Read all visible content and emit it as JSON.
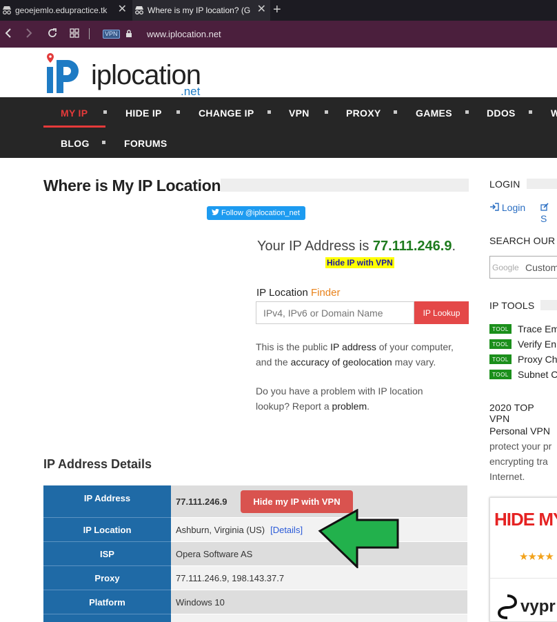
{
  "browser": {
    "tabs": [
      {
        "title": "geoejemlo.edupractice.tk",
        "active": false
      },
      {
        "title": "Where is my IP location? (G",
        "active": true
      }
    ],
    "vpn_badge": "VPN",
    "url": "www.iplocation.net"
  },
  "site": {
    "logo_text": "iplocation",
    "logo_tld": ".net",
    "nav": {
      "row1": [
        "MY IP",
        "HIDE IP",
        "CHANGE IP",
        "VPN",
        "PROXY",
        "GAMES",
        "DDOS",
        "W"
      ],
      "row2": [
        "BLOG",
        "FORUMS"
      ]
    }
  },
  "main": {
    "title": "Where is My IP Location?",
    "follow_button": "Follow @iplocation_net",
    "your_ip_prefix": "Your IP Address is",
    "your_ip": "77.111.246.9",
    "your_ip_suffix": ".",
    "hide_ip_vpn": "Hide IP with VPN",
    "finder_label": "IP Location",
    "finder_accent": "Finder",
    "input_placeholder": "IPv4, IPv6 or Domain Name",
    "lookup_button": "IP Lookup",
    "para1": {
      "a": "This is the public ",
      "b": "IP address",
      "c": " of your computer,",
      "d": "and the ",
      "e": "accuracy of geolocation",
      "f": " may vary."
    },
    "para2": {
      "a": "Do you have a problem with IP location",
      "b": "lookup? Report a ",
      "c": "problem",
      "d": "."
    },
    "details_heading": "IP Address Details",
    "details": {
      "rows": [
        {
          "key": "IP Address",
          "value": "77.111.246.9"
        },
        {
          "key": "IP Location",
          "value": "Ashburn, Virginia (US)"
        },
        {
          "key": "ISP",
          "value": "Opera Software AS"
        },
        {
          "key": "Proxy",
          "value": "77.111.246.9, 198.143.37.7"
        },
        {
          "key": "Platform",
          "value": "Windows 10"
        }
      ],
      "hide_button": "Hide my IP with VPN",
      "details_link": "[Details]"
    }
  },
  "sidebar": {
    "login_heading": "LOGIN",
    "login_link": "Login",
    "signup_partial": "S",
    "search_heading": "SEARCH OUR",
    "search_placeholder": "Custom",
    "google_label": "Google",
    "tools_heading": "IP TOOLS",
    "tool_badge": "TOOL",
    "tools": [
      "Trace Em",
      "Verify En",
      "Proxy Ch",
      "Subnet C"
    ],
    "vpn_heading": "2020 TOP VPN",
    "vpn_text": [
      "Personal VPN",
      "protect your pr",
      "encrypting tra",
      "Internet."
    ],
    "ad_title": "HIDE MY",
    "ad_brand": "vypr"
  },
  "colors": {
    "nav_active": "#e53a3a",
    "table_key": "#1f6aa6",
    "ip_green": "#1e7b1e",
    "arrow_green": "#22b14c"
  }
}
